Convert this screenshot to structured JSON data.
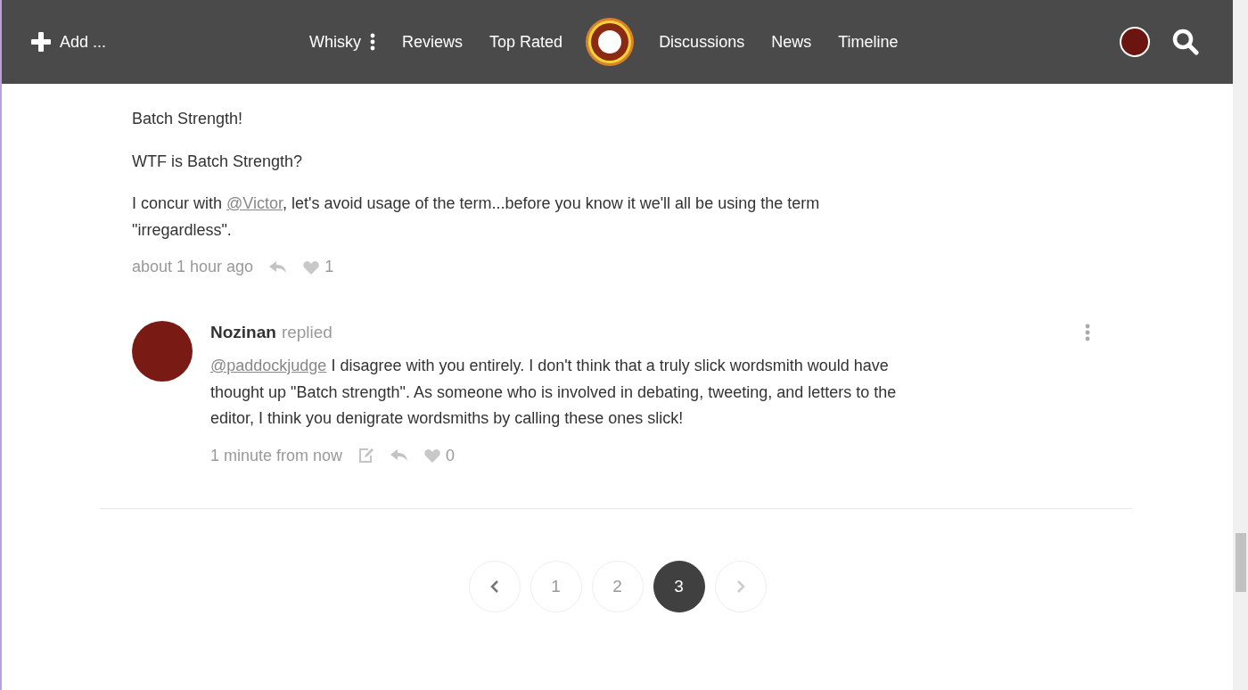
{
  "header": {
    "add_label": "Add ...",
    "nav": [
      {
        "kind": "menu",
        "label": "Whisky"
      },
      {
        "kind": "link",
        "label": "Reviews"
      },
      {
        "kind": "link",
        "label": "Top Rated"
      },
      {
        "kind": "logo"
      },
      {
        "kind": "link",
        "label": "Discussions"
      },
      {
        "kind": "link",
        "label": "News"
      },
      {
        "kind": "link",
        "label": "Timeline"
      }
    ]
  },
  "comments": [
    {
      "paragraphs": [
        [
          {
            "kind": "text",
            "text": "Batch Strength!"
          }
        ],
        [
          {
            "kind": "text",
            "text": "WTF is Batch Strength?"
          }
        ],
        [
          {
            "kind": "text",
            "text": "I concur with "
          },
          {
            "kind": "mention",
            "text": "@Victor"
          },
          {
            "kind": "text",
            "text": ", let's avoid usage of the term...before you know it we'll all be using the term \"irregardless\"."
          }
        ]
      ],
      "time": "about 1 hour ago",
      "actions": [
        {
          "kind": "reply"
        }
      ],
      "likes": "1"
    },
    {
      "author": "Nozinan",
      "action": "replied",
      "color": "#7a1a14",
      "paragraphs": [
        [
          {
            "kind": "mention",
            "text": "@paddockjudge"
          },
          {
            "kind": "text",
            "text": " I disagree with you entirely. I don't think that a truly slick wordsmith would have thought up \"Batch strength\". As someone who is involved in debating, tweeting, and letters to the editor, I think you denigrate wordsmiths by calling these ones slick!"
          }
        ]
      ],
      "time": "1 minute from now",
      "actions": [
        {
          "kind": "edit"
        },
        {
          "kind": "reply"
        }
      ],
      "likes": "0"
    }
  ],
  "pagination": {
    "prev": {
      "disabled": false
    },
    "pages": [
      {
        "label": "1",
        "selected": false
      },
      {
        "label": "2",
        "selected": false
      },
      {
        "label": "3",
        "selected": true
      }
    ],
    "next": {
      "disabled": true
    }
  }
}
